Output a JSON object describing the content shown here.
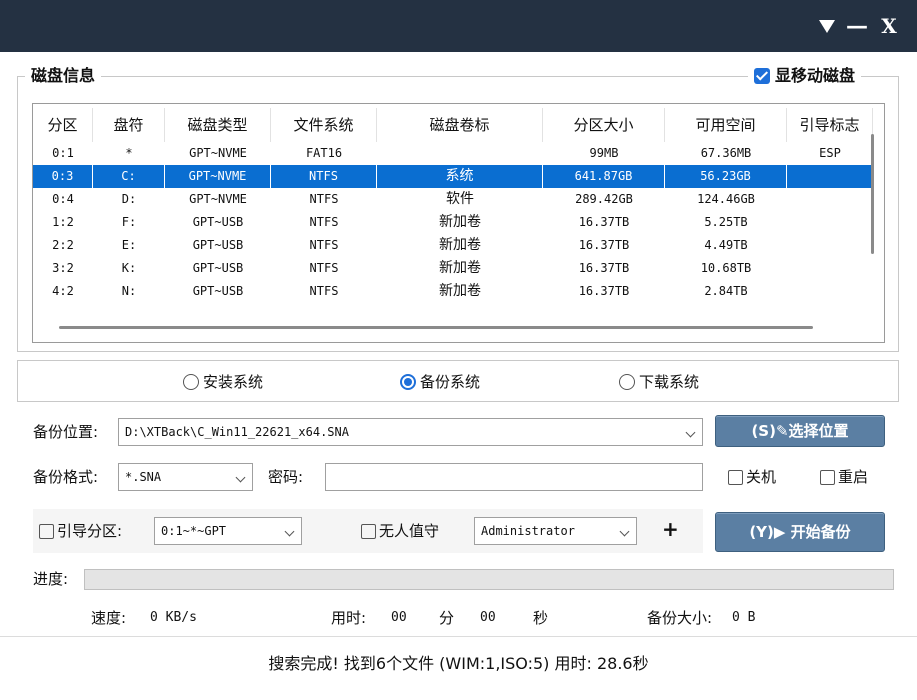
{
  "titlebar": {
    "menu_icon": "triangle-down",
    "minimize": "—",
    "close": "X"
  },
  "disk_group": {
    "title": "磁盘信息",
    "show_mobile_label": "显移动磁盘",
    "show_mobile_checked": true
  },
  "table": {
    "headers": [
      "分区",
      "盘符",
      "磁盘类型",
      "文件系统",
      "磁盘卷标",
      "分区大小",
      "可用空间",
      "引导标志"
    ],
    "rows": [
      [
        "0:1",
        "*",
        "GPT~NVME",
        "FAT16",
        "",
        "99MB",
        "67.36MB",
        "ESP"
      ],
      [
        "0:3",
        "C:",
        "GPT~NVME",
        "NTFS",
        "系统",
        "641.87GB",
        "56.23GB",
        ""
      ],
      [
        "0:4",
        "D:",
        "GPT~NVME",
        "NTFS",
        "软件",
        "289.42GB",
        "124.46GB",
        ""
      ],
      [
        "1:2",
        "F:",
        "GPT~USB",
        "NTFS",
        "新加卷",
        "16.37TB",
        "5.25TB",
        ""
      ],
      [
        "2:2",
        "E:",
        "GPT~USB",
        "NTFS",
        "新加卷",
        "16.37TB",
        "4.49TB",
        ""
      ],
      [
        "3:2",
        "K:",
        "GPT~USB",
        "NTFS",
        "新加卷",
        "16.37TB",
        "10.68TB",
        ""
      ],
      [
        "4:2",
        "N:",
        "GPT~USB",
        "NTFS",
        "新加卷",
        "16.37TB",
        "2.84TB",
        ""
      ]
    ],
    "selected_row": 1
  },
  "mode": {
    "options": [
      "安装系统",
      "备份系统",
      "下载系统"
    ],
    "selected": 1
  },
  "backup": {
    "location_label": "备份位置:",
    "location_value": "D:\\XTBack\\C_Win11_22621_x64.SNA",
    "choose_button": "(S)✎选择位置",
    "format_label": "备份格式:",
    "format_value": "*.SNA",
    "password_label": "密码:",
    "password_value": "",
    "shutdown_label": "关机",
    "restart_label": "重启",
    "boot_partition_label": "引导分区:",
    "boot_partition_value": "0:1~*~GPT",
    "unattended_label": "无人值守",
    "user_value": "Administrator",
    "plus": "+",
    "start_button": "(Y)▶ 开始备份"
  },
  "progress": {
    "label": "进度:",
    "fraction": 0
  },
  "stats": {
    "speed_label": "速度:",
    "speed_value": "0 KB/s",
    "time_label": "用时:",
    "minutes": "00",
    "minutes_unit": "分",
    "seconds": "00",
    "seconds_unit": "秒",
    "size_label": "备份大小:",
    "size_value": "0 B"
  },
  "status": {
    "text": "搜索完成! 找到6个文件 (WIM:1,ISO:5) 用时: 28.6秒"
  }
}
